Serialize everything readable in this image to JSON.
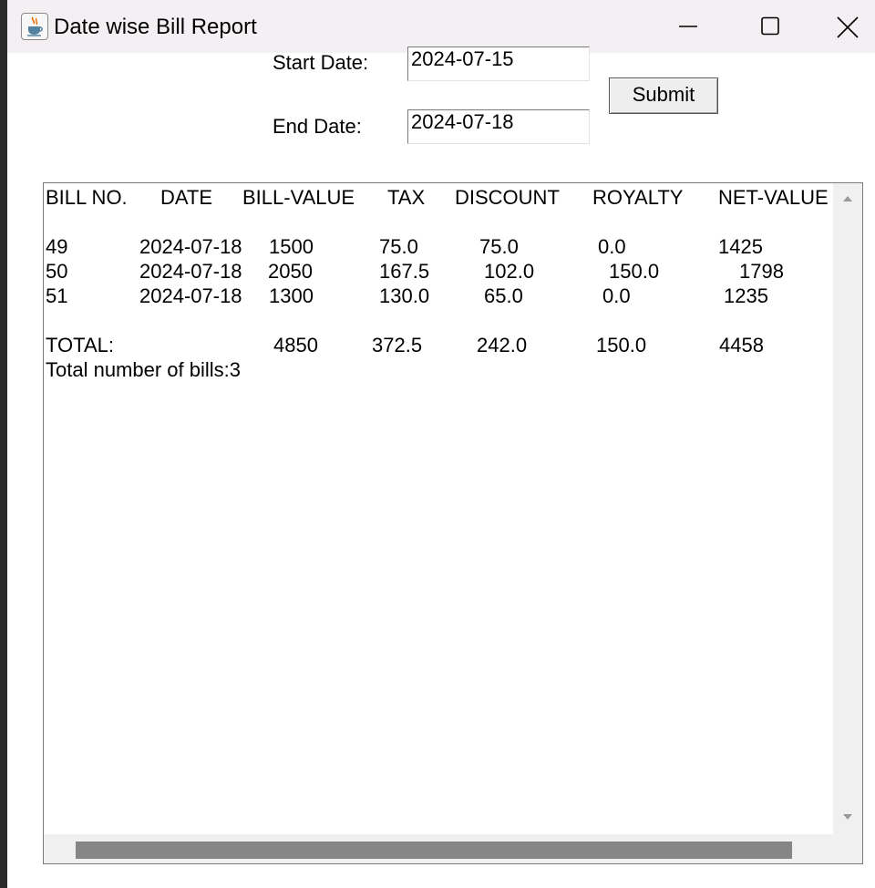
{
  "window": {
    "title": "Date wise Bill Report",
    "icon": "java-cup-icon"
  },
  "form": {
    "start_label": "Start Date:",
    "start_value": "2024-07-15",
    "end_label": "End Date:",
    "end_value": "2024-07-18",
    "submit_label": "Submit"
  },
  "report": {
    "headers": [
      "BILL NO.",
      "DATE",
      "BILL-VALUE",
      "TAX",
      "DISCOUNT",
      "ROYALTY",
      "NET-VALUE"
    ],
    "rows": [
      [
        "49",
        "2024-07-18",
        "1500",
        "75.0",
        "75.0",
        "0.0",
        "1425"
      ],
      [
        "50",
        "2024-07-18",
        "2050",
        "167.5",
        "102.0",
        "150.0",
        "1798"
      ],
      [
        "51",
        "2024-07-18",
        "1300",
        "130.0",
        "65.0",
        "0.0",
        "1235"
      ]
    ],
    "total": [
      "TOTAL:",
      "4850",
      "372.5",
      "242.0",
      "150.0",
      "4458"
    ],
    "bill_count": "Total number of bills:3"
  }
}
